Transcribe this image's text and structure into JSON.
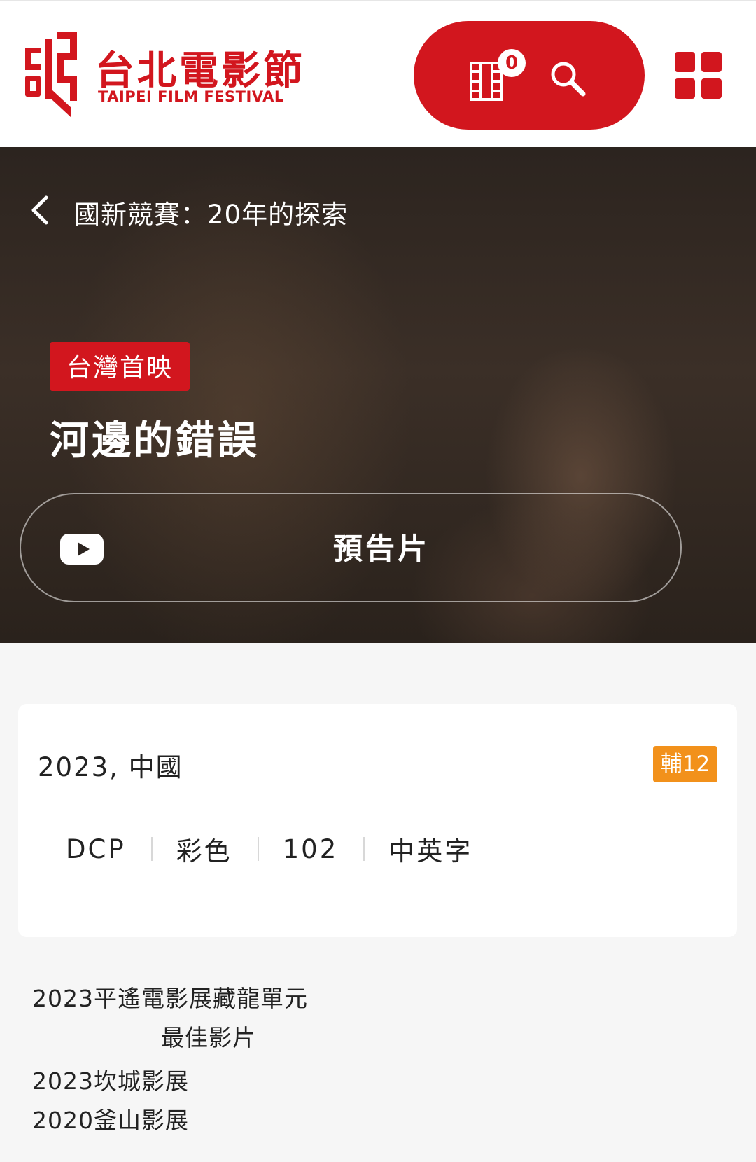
{
  "header": {
    "logo_zh": "台北電影節",
    "logo_en": "TAIPEI FILM FESTIVAL",
    "cart_count": "0",
    "icons": [
      "film-reel-icon",
      "search-icon",
      "grid-menu-icon"
    ],
    "brand_color": "#d2161e"
  },
  "hero": {
    "back_label": "國新競賽：20年的探索",
    "premiere_badge": "台灣首映",
    "title": "河邊的錯誤",
    "trailer_label": "預告片",
    "trailer_icon": "youtube-play-icon"
  },
  "info": {
    "year_country": "2023, 中國",
    "rating": "輔12",
    "rating_color": "#f2911b",
    "format": "DCP",
    "color": "彩色",
    "runtime": "102",
    "subtitles": "中英字"
  },
  "awards": [
    "2023平遙電影展藏龍單元",
    "最佳影片",
    "2023坎城影展",
    "2020釜山影展"
  ]
}
